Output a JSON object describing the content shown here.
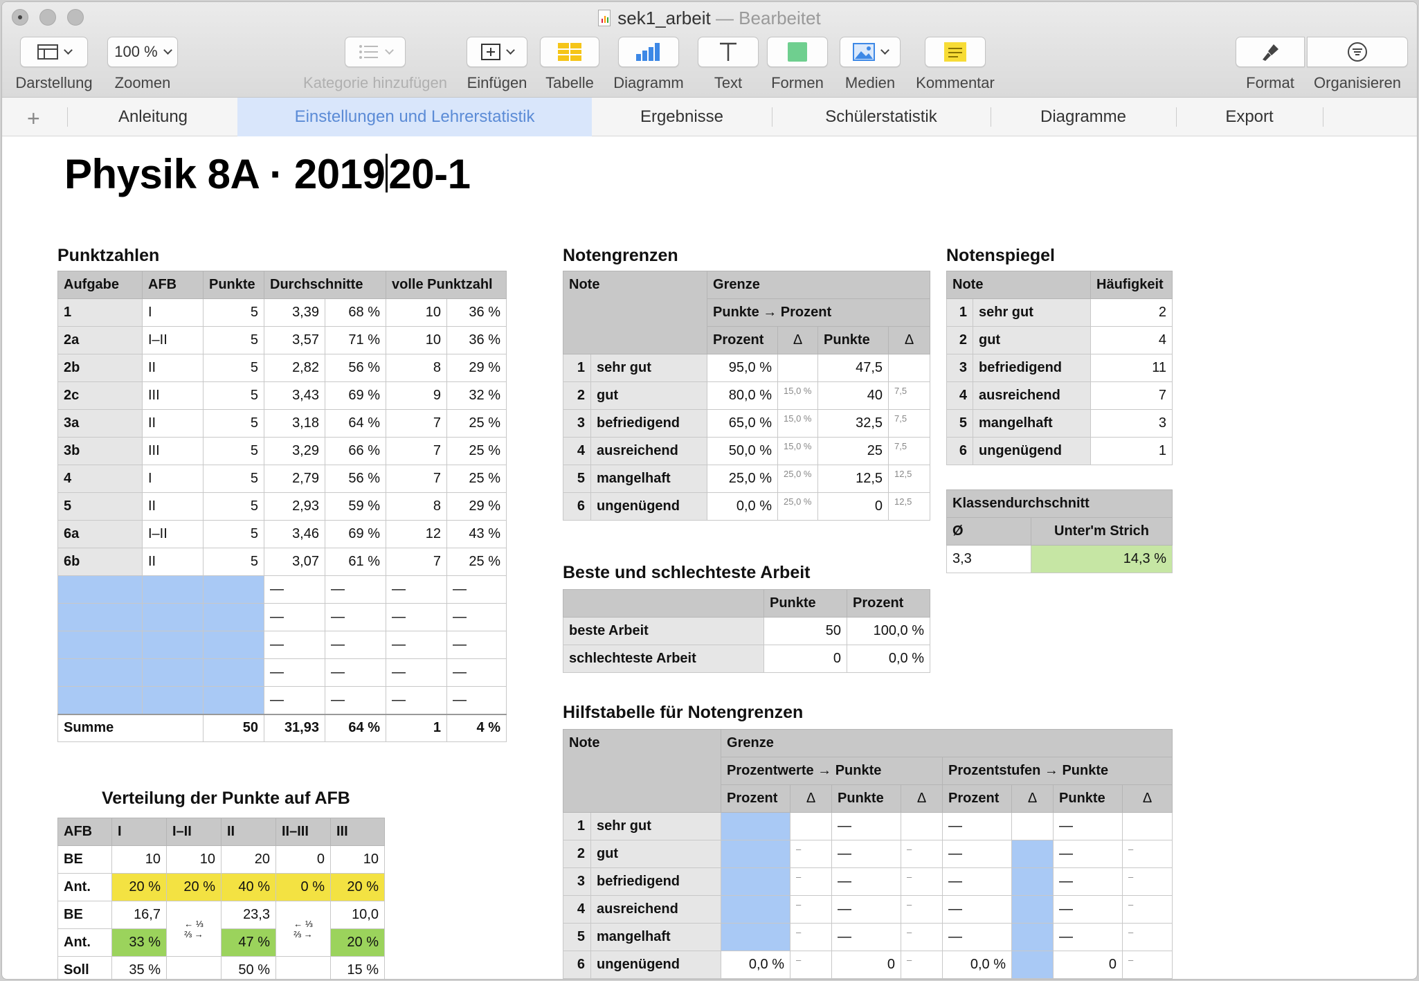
{
  "window": {
    "doc_name": "sek1_arbeit",
    "doc_status": "— Bearbeitet"
  },
  "toolbar": {
    "darstellung": "Darstellung",
    "zoom_value": "100 %",
    "zoomen": "Zoomen",
    "kategorie": "Kategorie hinzufügen",
    "einfuegen": "Einfügen",
    "tabelle": "Tabelle",
    "diagramm": "Diagramm",
    "text": "Text",
    "formen": "Formen",
    "medien": "Medien",
    "kommentar": "Kommentar",
    "format": "Format",
    "organisieren": "Organisieren",
    "icons": [
      "sidebar-view-icon",
      "list-icon",
      "insert-icon",
      "table-icon",
      "chart-icon",
      "text-icon",
      "shape-icon",
      "media-icon",
      "comment-icon",
      "paintbrush-icon",
      "organize-filter-icon"
    ],
    "colors": {
      "table_icon": "#f5c518",
      "shape_icon": "#6fcf8f",
      "comment_icon": "#f7dc36",
      "chart_icon": "#3d88e6"
    }
  },
  "tabs": {
    "anleitung": "Anleitung",
    "einstellungen": "Einstellungen und Lehrerstatistik",
    "ergebnisse": "Ergebnisse",
    "schuelerstatistik": "Schülerstatistik",
    "diagramme": "Diagramme",
    "export": "Export",
    "active": "Einstellungen und Lehrerstatistik"
  },
  "sheet": {
    "title_a": "Physik 8A · 2019",
    "title_b": "20-1"
  },
  "punktzahlen": {
    "title": "Punktzahlen",
    "headers": [
      "Aufgabe",
      "AFB",
      "Punkte",
      "Durchschnitte",
      "volle Punktzahl"
    ],
    "rows": [
      [
        "1",
        "I",
        "5",
        "3,39",
        "68 %",
        "10",
        "36 %"
      ],
      [
        "2a",
        "I–II",
        "5",
        "3,57",
        "71 %",
        "10",
        "36 %"
      ],
      [
        "2b",
        "II",
        "5",
        "2,82",
        "56 %",
        "8",
        "29 %"
      ],
      [
        "2c",
        "III",
        "5",
        "3,43",
        "69 %",
        "9",
        "32 %"
      ],
      [
        "3a",
        "II",
        "5",
        "3,18",
        "64 %",
        "7",
        "25 %"
      ],
      [
        "3b",
        "III",
        "5",
        "3,29",
        "66 %",
        "7",
        "25 %"
      ],
      [
        "4",
        "I",
        "5",
        "2,79",
        "56 %",
        "7",
        "25 %"
      ],
      [
        "5",
        "II",
        "5",
        "2,93",
        "59 %",
        "8",
        "29 %"
      ],
      [
        "6a",
        "I–II",
        "5",
        "3,46",
        "69 %",
        "12",
        "43 %"
      ],
      [
        "6b",
        "II",
        "5",
        "3,07",
        "61 %",
        "7",
        "25 %"
      ]
    ],
    "dash": "—",
    "sum": [
      "Summe",
      "50",
      "31,93",
      "64 %",
      "1",
      "4 %"
    ]
  },
  "verteilung": {
    "title": "Verteilung der Punkte auf AFB",
    "headers": [
      "AFB",
      "I",
      "I–II",
      "II",
      "II–III",
      "III"
    ],
    "be1": [
      "BE",
      "10",
      "10",
      "20",
      "0",
      "10"
    ],
    "ant1": [
      "Ant.",
      "20 %",
      "20 %",
      "40 %",
      "0 %",
      "20 %"
    ],
    "be2": [
      "BE",
      "16,7",
      "23,3",
      "10,0"
    ],
    "ant2": [
      "Ant.",
      "33 %",
      "47 %",
      "20 %"
    ],
    "split_a": "← ⅓",
    "split_b": "⅔ →",
    "soll": [
      "Soll",
      "35 %",
      "50 %",
      "15 %"
    ]
  },
  "notengrenzen": {
    "title": "Notengrenzen",
    "h_note": "Note",
    "h_grenze": "Grenze",
    "h_pp": "Punkte → Prozent",
    "h_prozent": "Prozent",
    "h_delta": "Δ",
    "h_punkte": "Punkte",
    "rows": [
      [
        "1",
        "sehr gut",
        "95,0 %",
        "",
        "47,5",
        ""
      ],
      [
        "2",
        "gut",
        "80,0 %",
        "15,0 %",
        "40",
        "7,5"
      ],
      [
        "3",
        "befriedigend",
        "65,0 %",
        "15,0 %",
        "32,5",
        "7,5"
      ],
      [
        "4",
        "ausreichend",
        "50,0 %",
        "15,0 %",
        "25",
        "7,5"
      ],
      [
        "5",
        "mangelhaft",
        "25,0 %",
        "25,0 %",
        "12,5",
        "12,5"
      ],
      [
        "6",
        "ungenügend",
        "0,0 %",
        "25,0 %",
        "0",
        "12,5"
      ]
    ]
  },
  "notenspiegel": {
    "title": "Notenspiegel",
    "headers": [
      "Note",
      "Häufigkeit"
    ],
    "rows": [
      [
        "1",
        "sehr gut",
        "2"
      ],
      [
        "2",
        "gut",
        "4"
      ],
      [
        "3",
        "befriedigend",
        "11"
      ],
      [
        "4",
        "ausreichend",
        "7"
      ],
      [
        "5",
        "mangelhaft",
        "3"
      ],
      [
        "6",
        "ungenügend",
        "1"
      ]
    ]
  },
  "klassendurchschnitt": {
    "title": "Klassendurchschnitt",
    "h_avg": "Ø",
    "h_strich": "Unter'm Strich",
    "avg": "3,3",
    "strich": "14,3 %"
  },
  "beste": {
    "title": "Beste und schlechteste Arbeit",
    "headers": [
      "Punkte",
      "Prozent"
    ],
    "rows": [
      [
        "beste Arbeit",
        "50",
        "100,0 %"
      ],
      [
        "schlechteste Arbeit",
        "0",
        "0,0 %"
      ]
    ]
  },
  "hilfstabelle": {
    "title": "Hilfstabelle für Notengrenzen",
    "h_note": "Note",
    "h_grenze": "Grenze",
    "h_pw": "Prozentwerte → Punkte",
    "h_ps": "Prozentstufen → Punkte",
    "h_prozent": "Prozent",
    "h_delta": "Δ",
    "h_punkte": "Punkte",
    "dash": "—",
    "small_dash": "–",
    "rows": [
      [
        "1",
        "sehr gut"
      ],
      [
        "2",
        "gut"
      ],
      [
        "3",
        "befriedigend"
      ],
      [
        "4",
        "ausreichend"
      ],
      [
        "5",
        "mangelhaft"
      ],
      [
        "6",
        "ungenügend"
      ]
    ],
    "last": {
      "pw_prozent": "0,0 %",
      "pw_punkte": "0",
      "ps_prozent": "0,0 %",
      "ps_punkte": "0"
    }
  }
}
